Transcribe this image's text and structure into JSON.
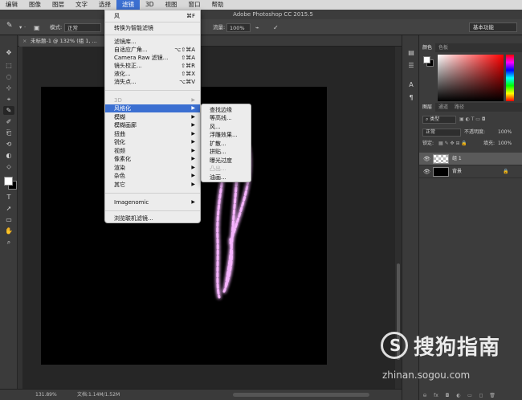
{
  "menubar": {
    "items": [
      "编辑",
      "图像",
      "图层",
      "文字",
      "选择",
      "滤镜",
      "3D",
      "视图",
      "窗口",
      "帮助"
    ],
    "active": "滤镜"
  },
  "titlebar": {
    "title": "Adobe Photoshop CC 2015.5"
  },
  "options": {
    "mode_label": "模式:",
    "mode_value": "正常",
    "flow_label": "流量:",
    "flow_value": "100%",
    "workspace": "基本功能"
  },
  "document": {
    "tab_title": "未标题-1 @ 132% (组 1, ..."
  },
  "filter_menu": {
    "items": [
      {
        "label": "风",
        "shortcut": "⌘F",
        "disabled": false
      },
      {
        "label": "转换为智能滤镜",
        "shortcut": "",
        "disabled": false
      },
      {
        "label": "滤镜库...",
        "shortcut": "",
        "disabled": false
      },
      {
        "label": "自适应广角...",
        "shortcut": "⌥⇧⌘A",
        "disabled": false
      },
      {
        "label": "Camera Raw 滤镜...",
        "shortcut": "⇧⌘A",
        "disabled": false
      },
      {
        "label": "镜头校正...",
        "shortcut": "⇧⌘R",
        "disabled": false
      },
      {
        "label": "液化...",
        "shortcut": "⇧⌘X",
        "disabled": false
      },
      {
        "label": "消失点...",
        "shortcut": "⌥⌘V",
        "disabled": false
      },
      {
        "label": "3D",
        "submenu": true,
        "disabled": true
      },
      {
        "label": "风格化",
        "submenu": true,
        "highlighted": true
      },
      {
        "label": "模糊",
        "submenu": true
      },
      {
        "label": "模糊画廊",
        "submenu": true
      },
      {
        "label": "扭曲",
        "submenu": true
      },
      {
        "label": "锐化",
        "submenu": true
      },
      {
        "label": "视频",
        "submenu": true
      },
      {
        "label": "像素化",
        "submenu": true
      },
      {
        "label": "渲染",
        "submenu": true
      },
      {
        "label": "杂色",
        "submenu": true
      },
      {
        "label": "其它",
        "submenu": true
      },
      {
        "label": "Imagenomic",
        "submenu": true
      },
      {
        "label": "浏览联机滤镜..."
      }
    ]
  },
  "stylize_submenu": {
    "items": [
      {
        "label": "查找边缘",
        "disabled": false
      },
      {
        "label": "等高线...",
        "disabled": false
      },
      {
        "label": "风...",
        "disabled": false
      },
      {
        "label": "浮雕效果...",
        "disabled": false
      },
      {
        "label": "扩散...",
        "disabled": false
      },
      {
        "label": "拼贴...",
        "disabled": false
      },
      {
        "label": "曝光过度",
        "disabled": false
      },
      {
        "label": "凸出...",
        "disabled": true
      },
      {
        "label": "油画...",
        "disabled": false
      }
    ]
  },
  "color_panel": {
    "tabs": [
      "颜色",
      "色板"
    ],
    "fg_color": "#ffffff",
    "bg_color": "#000000"
  },
  "layers_panel": {
    "tabs": [
      "图层",
      "通道",
      "路径"
    ],
    "filter_type": "类型",
    "blend_mode": "正常",
    "opacity_label": "不透明度:",
    "opacity_value": "100%",
    "lock_label": "锁定:",
    "fill_label": "填充:",
    "fill_value": "100%",
    "layers": [
      {
        "name": "组 1",
        "selected": true,
        "locked": false
      },
      {
        "name": "背景",
        "selected": false,
        "locked": true
      }
    ],
    "footer_icons": [
      "link-icon",
      "fx-icon",
      "mask-icon",
      "adjustment-icon",
      "folder-icon",
      "new-layer-icon",
      "trash-icon"
    ],
    "footer_glyphs": [
      "⊖",
      "fx",
      "◘",
      "◐",
      "▭",
      "◻",
      "🗑"
    ]
  },
  "status": {
    "zoom": "131.89%",
    "doc_info": "文档:1.14M/1.52M"
  },
  "watermark": {
    "brand": "搜狗指南",
    "logo_letter": "S",
    "url": "zhinan.sogou.com"
  },
  "tool_glyphs": [
    "✥",
    "⬚",
    "◌",
    "⊹",
    "⌖",
    "✎",
    "✐",
    "⎗",
    "⟲",
    "◐",
    "⬦",
    "T",
    "➚",
    "▭",
    "✋",
    "⌕"
  ],
  "strip_glyphs": [
    "▤",
    "☰",
    "A",
    "¶"
  ]
}
